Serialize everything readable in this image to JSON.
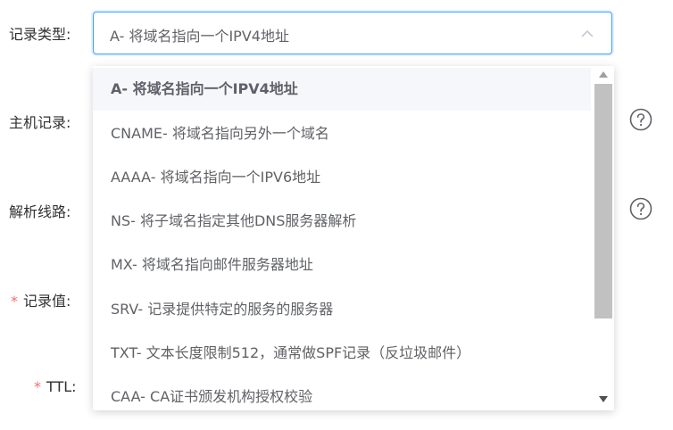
{
  "form": {
    "record_type_label": "记录类型:",
    "host_record_label": "主机记录:",
    "resolve_line_label": "解析线路:",
    "record_value_label": "记录值:",
    "ttl_label": "TTL:",
    "required_mark": "*"
  },
  "record_type_select": {
    "value": "A- 将域名指向一个IPV4地址",
    "expanded": true
  },
  "dropdown": {
    "options": [
      "A- 将域名指向一个IPV4地址",
      "CNAME- 将域名指向另外一个域名",
      "AAAA- 将域名指向一个IPV6地址",
      "NS- 将子域名指定其他DNS服务器解析",
      "MX- 将域名指向邮件服务器地址",
      "SRV- 记录提供特定的服务的服务器",
      "TXT- 文本长度限制512，通常做SPF记录（反垃圾邮件）",
      "CAA- CA证书颁发机构授权校验"
    ],
    "selected_index": 0
  },
  "colors": {
    "accent": "#409eff",
    "required": "#f56c6c",
    "selected_bg": "#f5f7fa",
    "scroll_thumb": "#c1c1c1"
  },
  "icons": {
    "select_arrow": "chevron-up-icon",
    "help": "question-circle-icon",
    "scroll_up": "triangle-up-icon",
    "scroll_down": "triangle-down-icon"
  }
}
